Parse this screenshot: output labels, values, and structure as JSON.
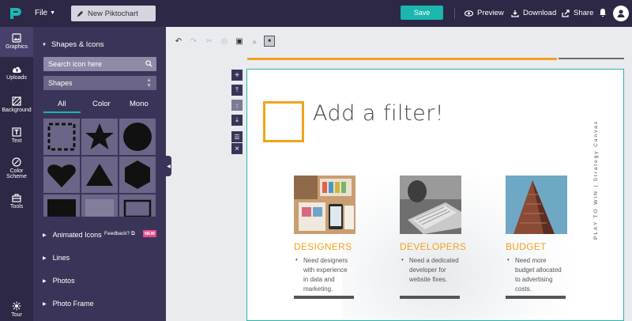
{
  "topbar": {
    "file_label": "File",
    "new_chart_label": "New Piktochart",
    "save_label": "Save",
    "preview_label": "Preview",
    "download_label": "Download",
    "share_label": "Share"
  },
  "rail": {
    "items": [
      {
        "label": "Graphics",
        "icon": "image-icon"
      },
      {
        "label": "Uploads",
        "icon": "cloud-upload-icon"
      },
      {
        "label": "Background",
        "icon": "background-icon"
      },
      {
        "label": "Text",
        "icon": "text-icon"
      },
      {
        "label": "Color",
        "label2": "Scheme",
        "icon": "palette-icon"
      },
      {
        "label": "Tools",
        "icon": "toolbox-icon"
      },
      {
        "label": "Tour",
        "icon": "tour-icon"
      }
    ]
  },
  "panel": {
    "heading": "Shapes & Icons",
    "search_placeholder": "Search icon here",
    "select_value": "Shapes",
    "tabs": [
      "All",
      "Color",
      "Mono"
    ],
    "shapes": [
      "dashed-square",
      "star",
      "circle",
      "heart",
      "triangle",
      "hexagon",
      "rectangle",
      "rectangle-light",
      "frame"
    ],
    "sections": [
      "Animated Icons",
      "Lines",
      "Photos",
      "Photo Frame"
    ],
    "feedback_label": "Feedback?",
    "new_badge": "NEW"
  },
  "canvas": {
    "headline": "Add a filter!",
    "vertical_text": "PLAY TO WIN | Strategy Canvas",
    "cards": [
      {
        "title": "DESIGNERS",
        "lines": [
          "Need designers",
          "with experience",
          "in data and",
          "marketing."
        ]
      },
      {
        "title": "DEVELOPERS",
        "lines": [
          "Need a dedicated",
          "developer for",
          "website fixes."
        ]
      },
      {
        "title": "BUDGET",
        "lines": [
          "Need more",
          "budget allocated",
          "to advertising",
          "costs."
        ]
      }
    ]
  },
  "colors": {
    "nav_dark": "#2c2845",
    "panel": "#3a3558",
    "accent": "#1bb7ae",
    "orange": "#f2a31c"
  }
}
